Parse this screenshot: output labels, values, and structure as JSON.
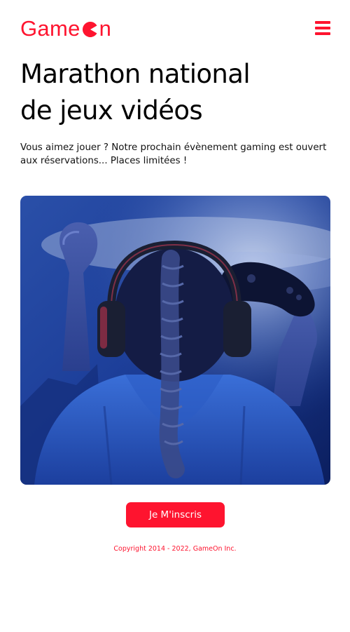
{
  "header": {
    "logo_part1": "Game",
    "logo_part2": "n",
    "menu_icon": "hamburger-menu-icon"
  },
  "hero": {
    "title_line1": "Marathon national",
    "title_line2": "de jeux vidéos",
    "description": "Vous aimez jouer ? Notre prochain évènement gaming est ouvert aux réservations... Places limitées !",
    "image_subject": "gamer-with-headset-and-controller-photo"
  },
  "cta": {
    "label": "Je M'inscris"
  },
  "footer": {
    "copyright": "Copyright 2014 - 2022, GameOn Inc."
  },
  "colors": {
    "brand": "#FE142F",
    "text": "#000000",
    "background": "#FFFFFF"
  }
}
